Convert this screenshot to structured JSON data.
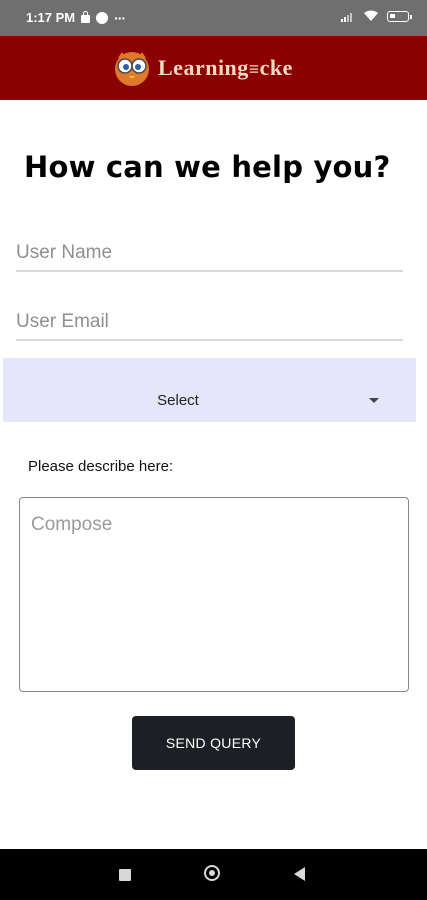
{
  "status_bar": {
    "time": "1:17 PM",
    "overflow": "···",
    "battery_level": 0.3,
    "icons": [
      "lock-icon",
      "chat-bubble-icon",
      "more-dots-icon",
      "signal-icon",
      "wifi-icon",
      "battery-icon"
    ]
  },
  "header": {
    "brand": "Learning",
    "brand_suffix": "cke",
    "background": "#8b0000",
    "logo_icon": "owl-mascot-icon"
  },
  "form": {
    "title": "How can we help you?",
    "user_name_placeholder": "User Name",
    "user_email_placeholder": "User Email",
    "select_value": "Select",
    "describe_label": "Please describe here:",
    "compose_placeholder": "Compose",
    "send_label": "SEND QUERY"
  },
  "nav": {
    "icons": [
      "recent-apps-icon",
      "home-icon",
      "back-icon"
    ]
  }
}
